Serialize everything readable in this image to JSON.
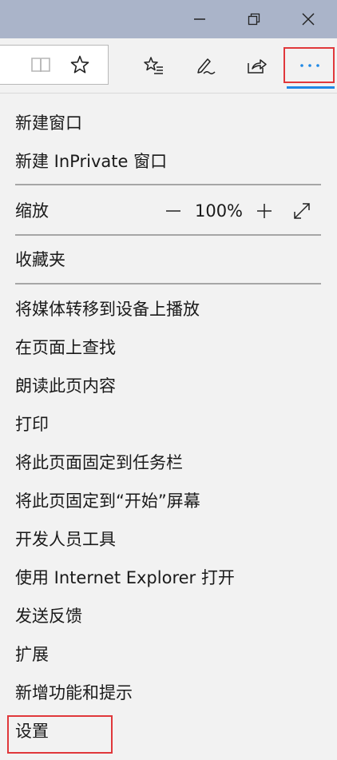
{
  "window": {
    "controls": [
      "minimize",
      "restore",
      "close"
    ]
  },
  "toolbar": {
    "icons": [
      "reading-view-icon",
      "favorite-star-icon",
      "favorites-hub-icon",
      "web-note-icon",
      "share-icon",
      "more-icon"
    ],
    "more_label": "···",
    "accent_color": "#1e88e5",
    "highlight_color": "#e0383b"
  },
  "menu": {
    "new_window": "新建窗口",
    "new_inprivate": "新建 InPrivate 窗口",
    "zoom_label": "缩放",
    "zoom_value": "100%",
    "favorites": "收藏夹",
    "cast_media": "将媒体转移到设备上播放",
    "find_on_page": "在页面上查找",
    "read_aloud": "朗读此页内容",
    "print": "打印",
    "pin_taskbar": "将此页面固定到任务栏",
    "pin_start": "将此页固定到“开始”屏幕",
    "dev_tools": "开发人员工具",
    "open_ie": "使用 Internet Explorer 打开",
    "feedback": "发送反馈",
    "extensions": "扩展",
    "whats_new": "新增功能和提示",
    "settings": "设置"
  }
}
